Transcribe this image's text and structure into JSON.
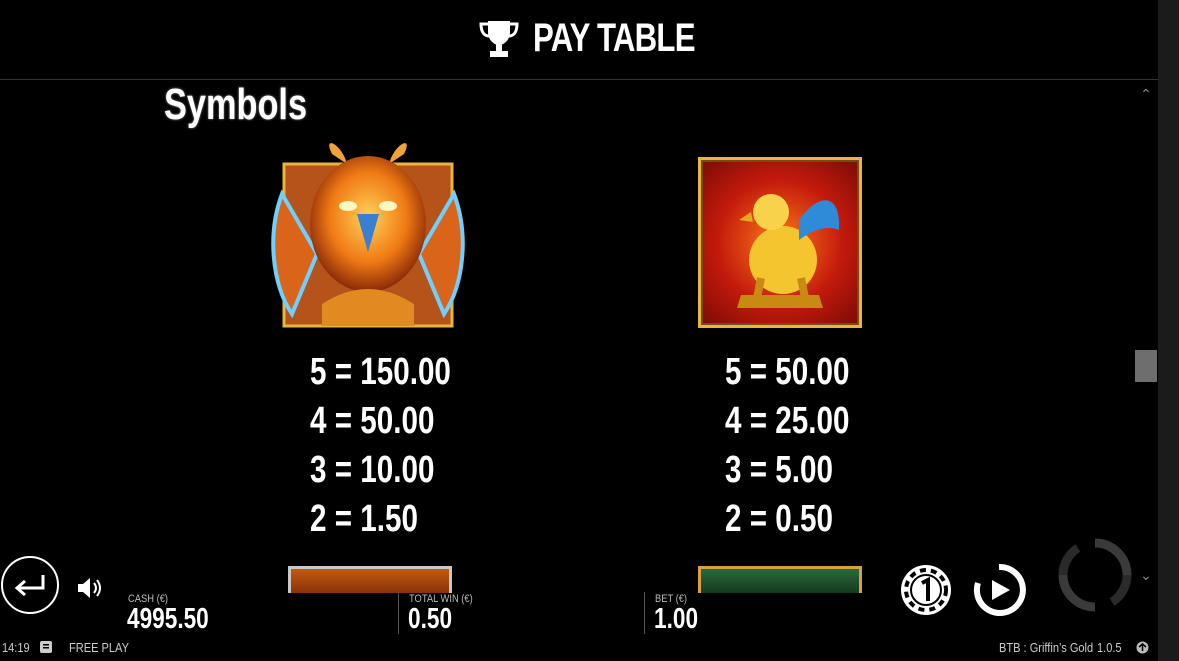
{
  "header": {
    "title": "PAY TABLE",
    "icon": "trophy-icon"
  },
  "section": {
    "title": "Symbols"
  },
  "symbols": [
    {
      "icon": "griffin-symbol-icon",
      "pays": [
        "5 = 150.00",
        "4 = 50.00",
        "3 = 10.00",
        "2 = 1.50"
      ]
    },
    {
      "icon": "golden-griffin-statue-icon",
      "pays": [
        "5 = 50.00",
        "4 = 25.00",
        "3 = 5.00",
        "2 = 0.50"
      ]
    }
  ],
  "bottom": {
    "cash_label": "CASH (€)",
    "cash_value": "4995.50",
    "total_win_label": "TOTAL WIN (€)",
    "total_win_value": "0.50",
    "bet_label": "BET (€)",
    "bet_value": "1.00"
  },
  "footer": {
    "time": "14:19",
    "mode": "FREE PLAY",
    "game": "BTB : Griffin’s Gold",
    "version": "1.0.5"
  },
  "colors": {
    "background": "#000000",
    "gold": "#e8b640",
    "text": "#ffffff"
  }
}
